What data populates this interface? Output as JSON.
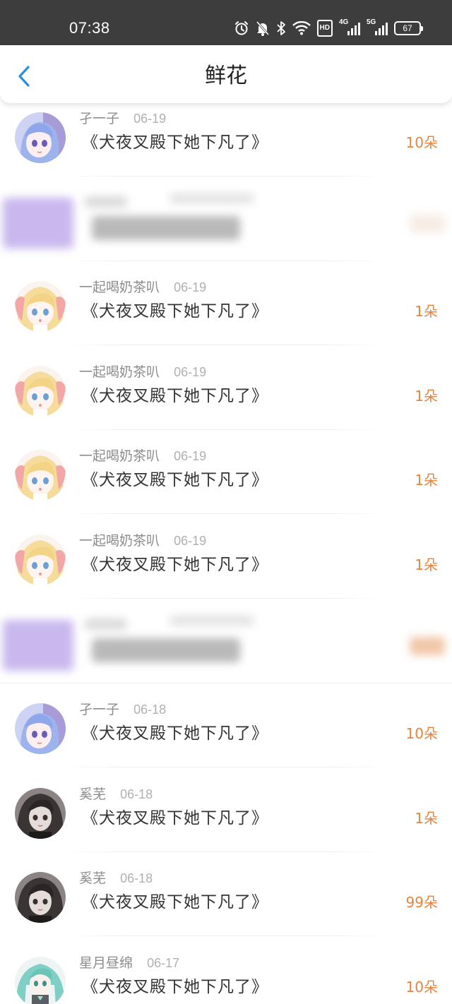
{
  "status_bar": {
    "time": "07:38",
    "icons": [
      "alarm-icon",
      "mute-icon",
      "bluetooth-icon",
      "wifi-icon",
      "hd-icon",
      "signal-4g-icon",
      "signal-5g-icon",
      "battery-icon"
    ],
    "hd_label": "HD",
    "net1_label": "4G",
    "net2_label": "5G",
    "battery_level": "67"
  },
  "header": {
    "title": "鲜花",
    "back_icon": "chevron-left-icon"
  },
  "colors": {
    "accent_blue": "#2b8de8",
    "count_orange": "#e8833a",
    "name_gray": "#8c8c8c"
  },
  "rows": [
    {
      "user": "孑一子",
      "date": "06-19",
      "book": "《犬夜叉殿下她下凡了》",
      "count": "10朵",
      "avatar": "avatar-blue-hair-girl"
    },
    {
      "redacted": true
    },
    {
      "user": "一起喝奶茶叭",
      "date": "06-19",
      "book": "《犬夜叉殿下她下凡了》",
      "count": "1朵",
      "avatar": "avatar-blonde-girl"
    },
    {
      "user": "一起喝奶茶叭",
      "date": "06-19",
      "book": "《犬夜叉殿下她下凡了》",
      "count": "1朵",
      "avatar": "avatar-blonde-girl"
    },
    {
      "user": "一起喝奶茶叭",
      "date": "06-19",
      "book": "《犬夜叉殿下她下凡了》",
      "count": "1朵",
      "avatar": "avatar-blonde-girl"
    },
    {
      "user": "一起喝奶茶叭",
      "date": "06-19",
      "book": "《犬夜叉殿下她下凡了》",
      "count": "1朵",
      "avatar": "avatar-blonde-girl"
    },
    {
      "redacted": true
    },
    {
      "user": "孑一子",
      "date": "06-18",
      "book": "《犬夜叉殿下她下凡了》",
      "count": "10朵",
      "avatar": "avatar-blue-hair-girl"
    },
    {
      "user": "奚芜",
      "date": "06-18",
      "book": "《犬夜叉殿下她下凡了》",
      "count": "1朵",
      "avatar": "avatar-dark-hair-girl"
    },
    {
      "user": "奚芜",
      "date": "06-18",
      "book": "《犬夜叉殿下她下凡了》",
      "count": "99朵",
      "avatar": "avatar-dark-hair-girl"
    },
    {
      "user": "星月昼绵",
      "date": "06-17",
      "book": "《犬夜叉殿下她下凡了》",
      "count": "10朵",
      "avatar": "avatar-teal-hair-girl"
    }
  ]
}
